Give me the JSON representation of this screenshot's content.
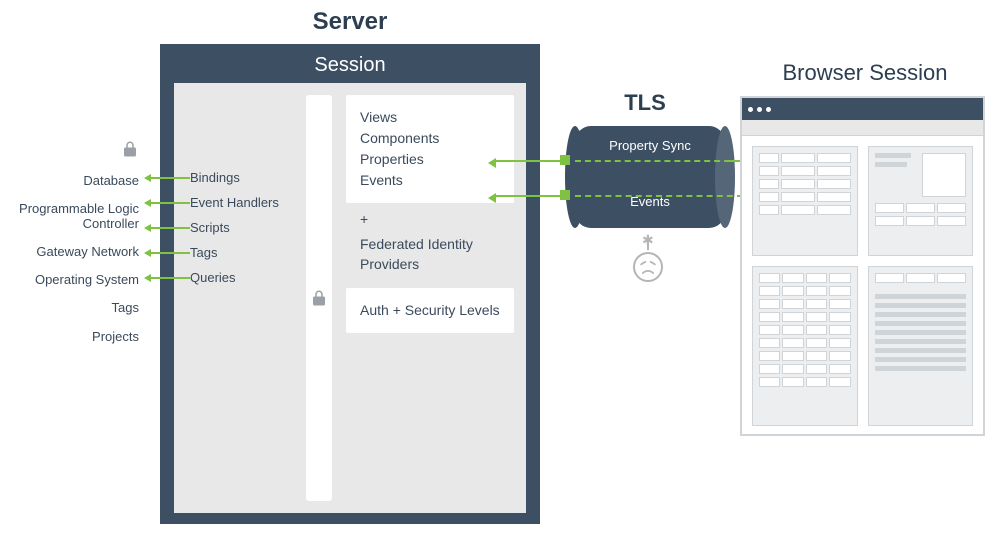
{
  "external": {
    "items": [
      "Database",
      "Programmable Logic Controller",
      "Gateway Network",
      "Operating System",
      "Tags",
      "Projects"
    ]
  },
  "server": {
    "title": "Server",
    "session_title": "Session",
    "bindings": [
      "Bindings",
      "Event Handlers",
      "Scripts",
      "Tags",
      "Queries"
    ],
    "views_box": [
      "Views",
      "Components",
      "Properties",
      "Events"
    ],
    "plus": "+",
    "federated": "Federated Identity Providers",
    "auth_box": "Auth + Security Levels"
  },
  "tls": {
    "title": "TLS",
    "top_label": "Property Sync",
    "bottom_label": "Events"
  },
  "browser": {
    "title": "Browser Session"
  }
}
